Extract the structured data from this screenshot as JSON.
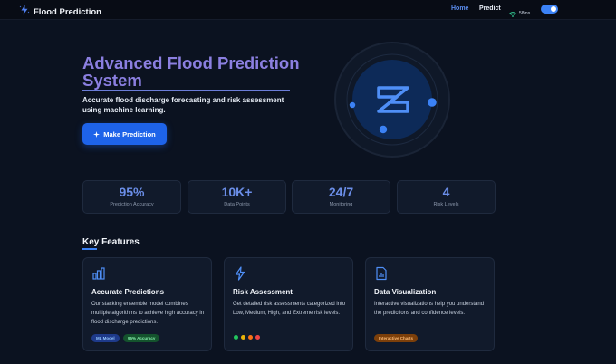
{
  "nav": {
    "brand": "Flood Prediction",
    "links": [
      {
        "label": "Home",
        "active": true
      },
      {
        "label": "Predict",
        "active": false
      }
    ],
    "ping": "58ms",
    "toggle_on": true
  },
  "hero": {
    "title": "Advanced Flood Prediction System",
    "subtitle": "Accurate flood discharge forecasting and risk assessment using machine learning.",
    "cta_label": "Make Prediction"
  },
  "stats": [
    {
      "value": "95%",
      "label": "Prediction Accuracy"
    },
    {
      "value": "10K+",
      "label": "Data Points"
    },
    {
      "value": "24/7",
      "label": "Monitoring"
    },
    {
      "value": "4",
      "label": "Risk Levels"
    }
  ],
  "features": {
    "title": "Key Features",
    "cards": [
      {
        "icon": "bar-chart-icon",
        "title": "Accurate Predictions",
        "text": "Our stacking ensemble model combines multiple algorithms to achieve high accuracy in flood discharge predictions.",
        "tags": [
          "ML Model",
          "95% Accuracy"
        ]
      },
      {
        "icon": "lightning-icon",
        "title": "Risk Assessment",
        "text": "Get detailed risk assessments categorized into Low, Medium, High, and Extreme risk levels.",
        "risk_colors": [
          "#22c55e",
          "#eab308",
          "#f97316",
          "#ef4444"
        ]
      },
      {
        "icon": "document-chart-icon",
        "title": "Data Visualization",
        "text": "Interactive visualizations help you understand the predictions and confidence levels.",
        "tags": [
          "Interactive Charts"
        ]
      }
    ]
  },
  "colors": {
    "accent": "#3b82f6",
    "background": "#0b1220",
    "card": "#111a2b"
  }
}
